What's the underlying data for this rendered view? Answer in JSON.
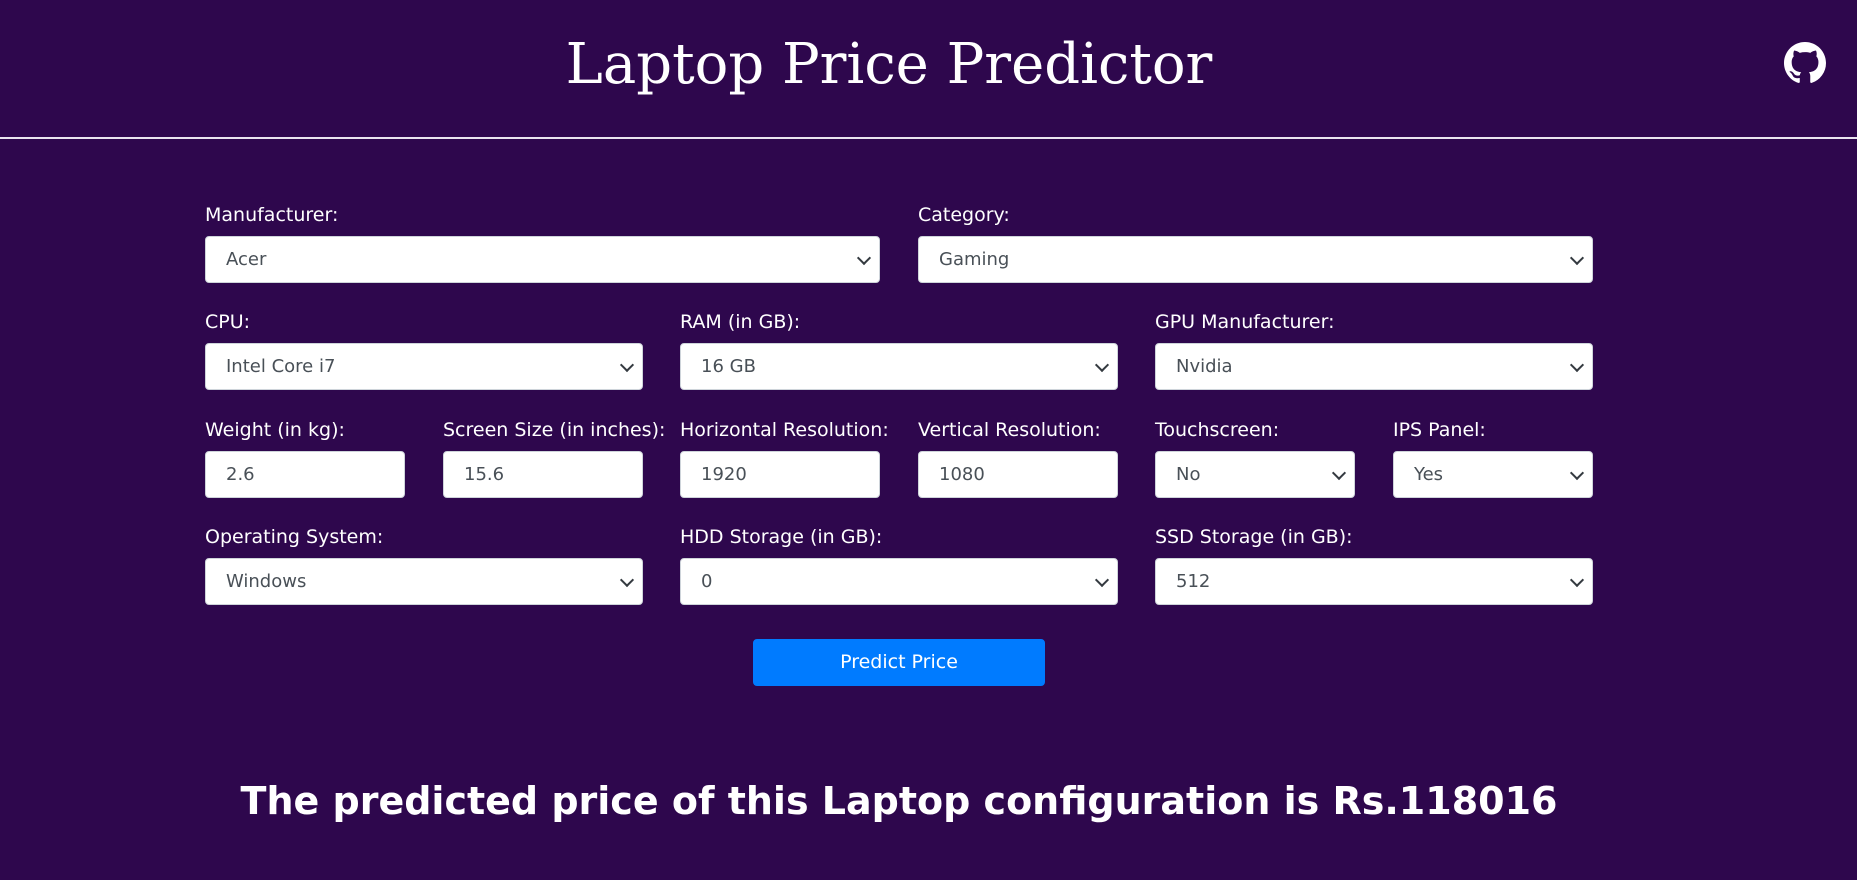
{
  "header": {
    "title": "Laptop Price Predictor",
    "github_icon": "github-icon"
  },
  "form": {
    "manufacturer": {
      "label": "Manufacturer:",
      "value": "Acer"
    },
    "category": {
      "label": "Category:",
      "value": "Gaming"
    },
    "cpu": {
      "label": "CPU:",
      "value": "Intel Core i7"
    },
    "ram": {
      "label": "RAM (in GB):",
      "value": "16 GB"
    },
    "gpu": {
      "label": "GPU Manufacturer:",
      "value": "Nvidia"
    },
    "weight": {
      "label": "Weight (in kg):",
      "value": "2.6"
    },
    "screen_size": {
      "label": "Screen Size (in inches):",
      "value": "15.6"
    },
    "horizontal_resolution": {
      "label": "Horizontal Resolution:",
      "value": "1920"
    },
    "vertical_resolution": {
      "label": "Vertical Resolution:",
      "value": "1080"
    },
    "touchscreen": {
      "label": "Touchscreen:",
      "value": "No"
    },
    "ips_panel": {
      "label": "IPS Panel:",
      "value": "Yes"
    },
    "os": {
      "label": "Operating System:",
      "value": "Windows"
    },
    "hdd": {
      "label": "HDD Storage (in GB):",
      "value": "0"
    },
    "ssd": {
      "label": "SSD Storage (in GB):",
      "value": "512"
    },
    "predict_label": "Predict Price"
  },
  "result": {
    "text": "The predicted price of this Laptop configuration is Rs.118016"
  },
  "colors": {
    "background": "#2e074d",
    "button": "#007bff",
    "text": "#ffffff"
  }
}
